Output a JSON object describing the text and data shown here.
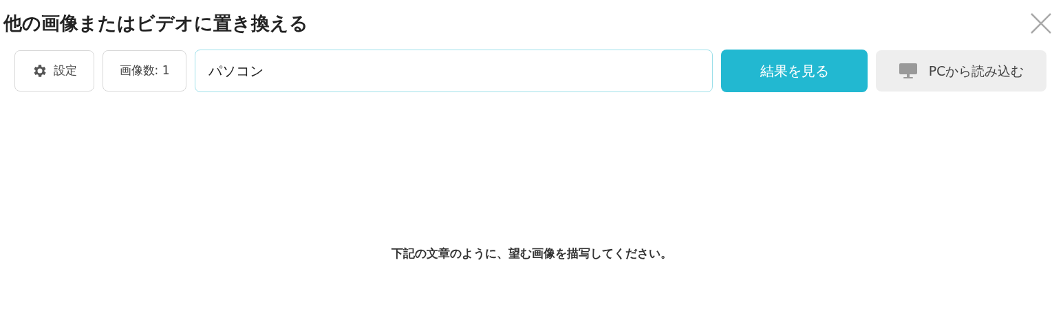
{
  "dialog": {
    "title": "他の画像またはビデオに置き換える"
  },
  "toolbar": {
    "settings_button": "設定",
    "count_button": "画像数: 1",
    "search": {
      "value": "パソコン"
    },
    "submit_button": "結果を見る",
    "upload_button": "PCから読み込む"
  },
  "hint": "下記の文章のように、望む画像を描写してください。"
}
